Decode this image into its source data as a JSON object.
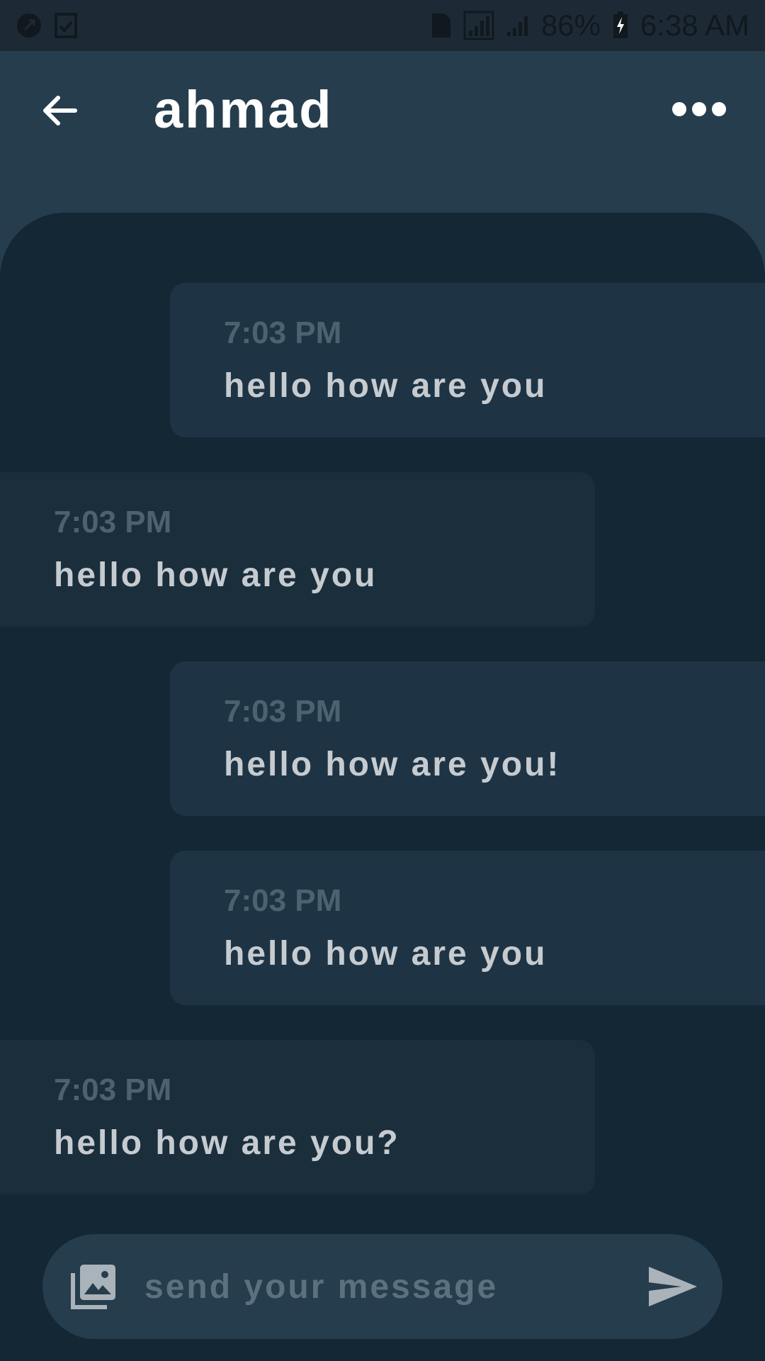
{
  "status_bar": {
    "battery_percent": "86%",
    "time": "6:38 AM"
  },
  "header": {
    "title": "ahmad",
    "back_icon": "arrow-left-icon",
    "more_icon": "more-horizontal-icon"
  },
  "messages": [
    {
      "direction": "sent",
      "time": "7:03 PM",
      "text": "hello how are you"
    },
    {
      "direction": "received",
      "time": "7:03 PM",
      "text": "hello how are you"
    },
    {
      "direction": "sent",
      "time": "7:03 PM",
      "text": "hello how are you!"
    },
    {
      "direction": "sent",
      "time": "7:03 PM",
      "text": "hello how are you"
    },
    {
      "direction": "received",
      "time": "7:03 PM",
      "text": "hello how are you?"
    }
  ],
  "composer": {
    "placeholder": "send your message",
    "value": "",
    "gallery_icon": "photo-library-icon",
    "send_icon": "send-icon"
  },
  "colors": {
    "header_bg": "#263d4d",
    "chat_bg": "#132734",
    "sent_bubble": "#1e3444",
    "received_bubble": "#1a2e3c",
    "timestamp": "#4d6270",
    "message_text": "#c6cbd0"
  }
}
